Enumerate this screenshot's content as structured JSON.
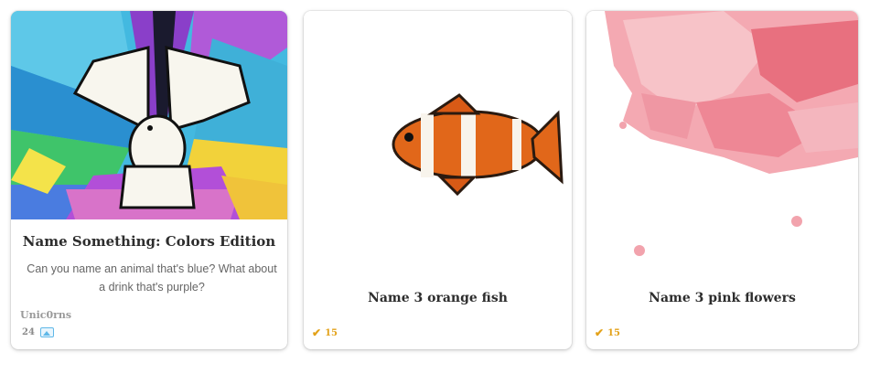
{
  "cards": [
    {
      "title": "Name Something: Colors Edition",
      "description": "Can you name an animal that's blue? What about a drink that's purple?",
      "author": "Unic0rns",
      "image_count": "24",
      "image_subject": "white dove over rainbow colors",
      "icon": "image-icon"
    },
    {
      "title": "Name 3 orange fish",
      "score": "15",
      "image_subject": "orange clownfish",
      "icon": "check-icon"
    },
    {
      "title": "Name 3 pink flowers",
      "score": "15",
      "image_subject": "pink flower blossoms",
      "icon": "check-icon"
    }
  ],
  "colors": {
    "score_accent": "#e3a21a",
    "image_icon": "#5fb8e8",
    "title_text": "#2d2d2d"
  }
}
